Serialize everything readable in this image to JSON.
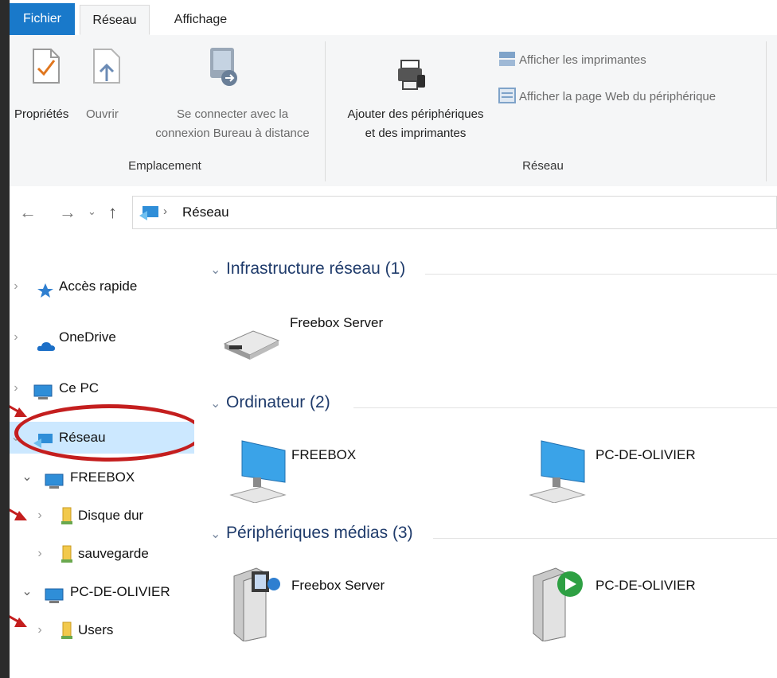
{
  "tabs": {
    "file": "Fichier",
    "network": "Réseau",
    "view": "Affichage"
  },
  "ribbon": {
    "properties": "Propriétés",
    "open": "Ouvrir",
    "remote_line1": "Se connecter avec la",
    "remote_line2": "connexion Bureau à distance",
    "group_location": "Emplacement",
    "add_devices_line1": "Ajouter des périphériques",
    "add_devices_line2": "et des imprimantes",
    "show_printers": "Afficher les imprimantes",
    "show_webpage": "Afficher la page Web du périphérique",
    "group_network": "Réseau"
  },
  "address": {
    "path": "Réseau"
  },
  "nav": {
    "quick_access": "Accès rapide",
    "onedrive": "OneDrive",
    "this_pc": "Ce PC",
    "network": "Réseau",
    "freebox": "FREEBOX",
    "hard_disk": "Disque dur",
    "backup": "sauvegarde",
    "pc_olivier": "PC-DE-OLIVIER",
    "users": "Users"
  },
  "content": {
    "groups": [
      {
        "title": "Infrastructure réseau (1)"
      },
      {
        "title": "Ordinateur (2)"
      },
      {
        "title": "Périphériques médias (3)"
      }
    ],
    "infra_items": [
      "Freebox Server"
    ],
    "computer_items": [
      "FREEBOX",
      "PC-DE-OLIVIER"
    ],
    "media_items": [
      "Freebox Server",
      "PC-DE-OLIVIER"
    ]
  },
  "colors": {
    "file_tab": "#1979ca",
    "selection": "#cce8ff",
    "annotation": "#c41e1e",
    "group_title": "#1f3b6b"
  }
}
